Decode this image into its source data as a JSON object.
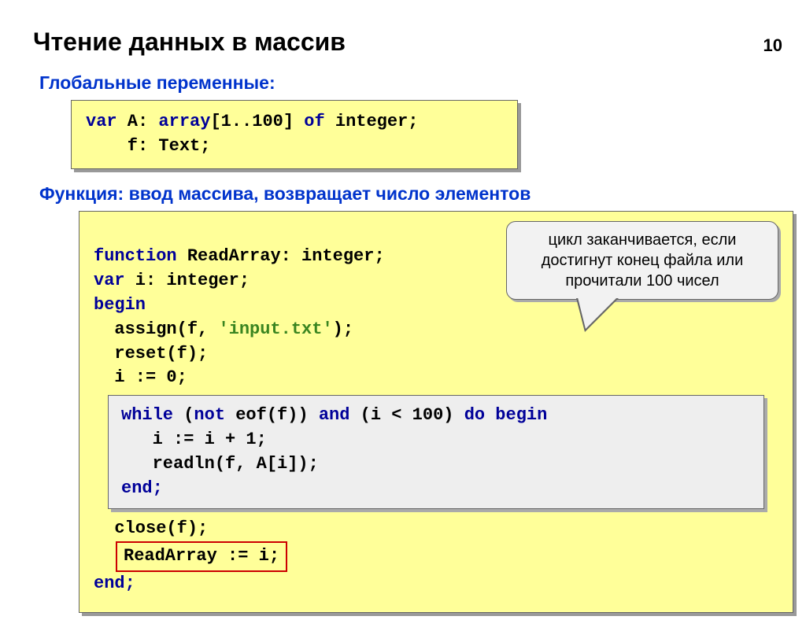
{
  "pageNumber": "10",
  "title": "Чтение данных в массив",
  "section1": "Глобальные переменные:",
  "code1": {
    "l1a": "var",
    "l1b": " A: ",
    "l1c": "array",
    "l1d": "[1..100] ",
    "l1e": "of",
    "l1f": " integer;",
    "l2": "    f: Text;"
  },
  "section2": "Функция: ввод массива, возвращает число элементов",
  "code2": {
    "l1a": "function",
    "l1b": " ReadArray: integer;",
    "l2a": "var",
    "l2b": " i: integer;",
    "l3": "begin",
    "l4a": "  assign(f, ",
    "l4b": "'input.txt'",
    "l4c": ");",
    "l5": "  reset(f);",
    "l6": "  i := 0;",
    "inner": {
      "l1a": "while",
      "l1b": " (",
      "l1c": "not",
      "l1d": " eof(f)) ",
      "l1e": "and",
      "l1f": " (i < 100) ",
      "l1g": "do begin",
      "l2": "   i := i + 1;",
      "l3": "   readln(f, A[i]);",
      "l4": "end;"
    },
    "l7": "  close(f);",
    "l8": "ReadArray := i;",
    "l9": "end;"
  },
  "callout": "цикл заканчивается, если достигнут конец файла или прочитали 100 чисел"
}
